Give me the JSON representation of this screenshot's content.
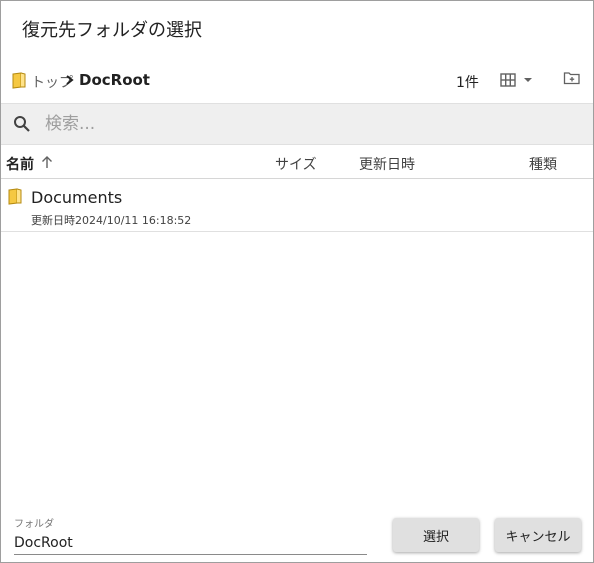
{
  "dialog": {
    "title": "復元先フォルダの選択"
  },
  "breadcrumb": {
    "top_label": "トップ",
    "current": "DocRoot"
  },
  "toolbar": {
    "item_count": "1件",
    "view_icon": "grid-view-icon",
    "new_folder_icon": "new-folder-icon"
  },
  "search": {
    "placeholder": "検索...",
    "value": ""
  },
  "columns": {
    "name": "名前",
    "size": "サイズ",
    "updated": "更新日時",
    "type": "種類"
  },
  "files": [
    {
      "name": "Documents",
      "meta": "更新日時2024/10/11 16:18:52",
      "icon": "folder-icon"
    }
  ],
  "footer": {
    "folder_label": "フォルダ",
    "folder_value": "DocRoot",
    "select_label": "選択",
    "cancel_label": "キャンセル"
  },
  "colors": {
    "folder": "#f5c842",
    "search_bg": "#efefef",
    "button_bg": "#e0e0e0"
  }
}
